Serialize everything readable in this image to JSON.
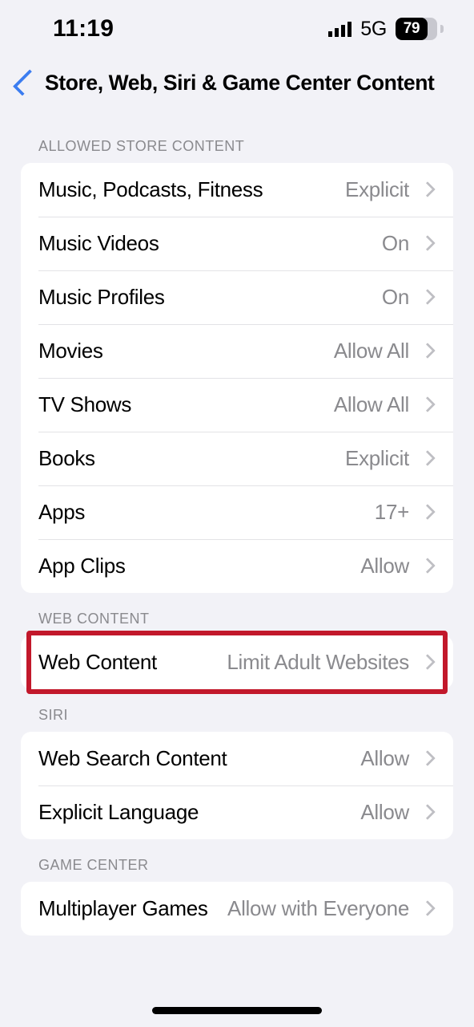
{
  "status_bar": {
    "time": "11:19",
    "signal_icon": "cellular-bars-icon",
    "network": "5G",
    "battery_percent": "79"
  },
  "nav": {
    "back_icon": "chevron-left-icon",
    "title": "Store, Web, Siri & Game Center Content"
  },
  "colors": {
    "background": "#F2F2F7",
    "card": "#FFFFFF",
    "accent_blue": "#3C7DF0",
    "secondary_text": "#8A8A8E",
    "highlight_red": "#C2182B"
  },
  "sections": [
    {
      "header": "ALLOWED STORE CONTENT",
      "rows": [
        {
          "label": "Music, Podcasts, Fitness",
          "value": "Explicit"
        },
        {
          "label": "Music Videos",
          "value": "On"
        },
        {
          "label": "Music Profiles",
          "value": "On"
        },
        {
          "label": "Movies",
          "value": "Allow All"
        },
        {
          "label": "TV Shows",
          "value": "Allow All"
        },
        {
          "label": "Books",
          "value": "Explicit"
        },
        {
          "label": "Apps",
          "value": "17+"
        },
        {
          "label": "App Clips",
          "value": "Allow"
        }
      ]
    },
    {
      "header": "WEB CONTENT",
      "highlighted": true,
      "rows": [
        {
          "label": "Web Content",
          "value": "Limit Adult Websites"
        }
      ]
    },
    {
      "header": "SIRI",
      "rows": [
        {
          "label": "Web Search Content",
          "value": "Allow"
        },
        {
          "label": "Explicit Language",
          "value": "Allow"
        }
      ]
    },
    {
      "header": "GAME CENTER",
      "rows": [
        {
          "label": "Multiplayer Games",
          "value": "Allow with Everyone"
        }
      ]
    }
  ]
}
